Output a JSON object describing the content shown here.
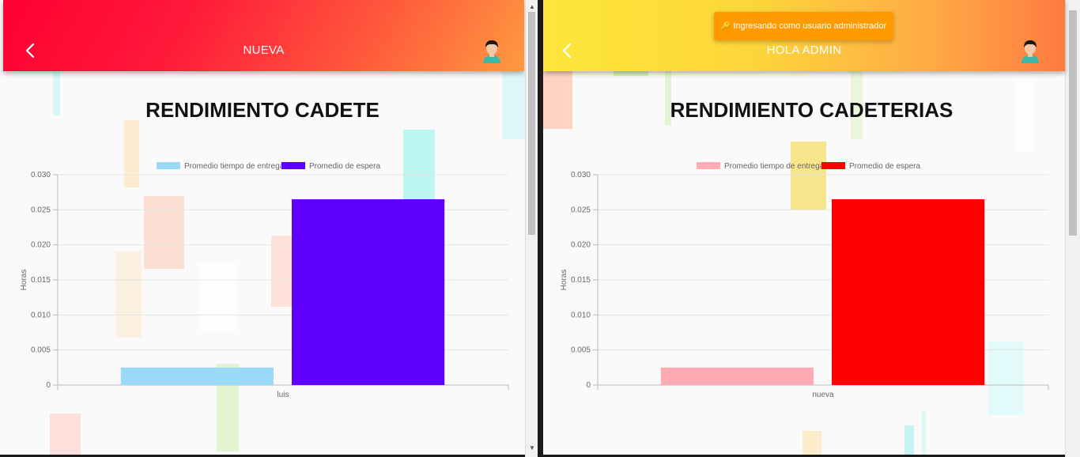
{
  "left": {
    "header": {
      "title": "NUEVA"
    },
    "heading": "RENDIMIENTO CADETE",
    "chart_data": {
      "type": "bar",
      "categories": [
        "luis"
      ],
      "series": [
        {
          "name": "Promedio tiempo de entrega",
          "values": [
            0.0025
          ],
          "color": "#9ad9f8"
        },
        {
          "name": "Promedio de espera",
          "values": [
            0.0265
          ],
          "color": "#5f00ff"
        }
      ],
      "ylabel": "Horas",
      "ylim": [
        0,
        0.03
      ],
      "yticks": [
        "0",
        "0.005",
        "0.010",
        "0.015",
        "0.020",
        "0.025",
        "0.030"
      ],
      "legend": "top-center",
      "grid": true
    }
  },
  "right": {
    "header": {
      "title": "HOLA ADMIN"
    },
    "toast": "Ingresando como usuario administrador",
    "heading": "RENDIMIENTO CADETERIAS",
    "chart_data": {
      "type": "bar",
      "categories": [
        "nueva"
      ],
      "series": [
        {
          "name": "Promedio tiempo de entrega",
          "values": [
            0.0025
          ],
          "color": "#ffabb4"
        },
        {
          "name": "Promedio de espera",
          "values": [
            0.0265
          ],
          "color": "#ff0000"
        }
      ],
      "ylabel": "Horas",
      "ylim": [
        0,
        0.03
      ],
      "yticks": [
        "0",
        "0.005",
        "0.010",
        "0.015",
        "0.020",
        "0.025",
        "0.030"
      ],
      "legend": "top-center",
      "grid": true
    }
  },
  "icons": {
    "back": "chevron-left-icon",
    "avatar": "user-avatar-icon",
    "toast": "key-icon"
  }
}
